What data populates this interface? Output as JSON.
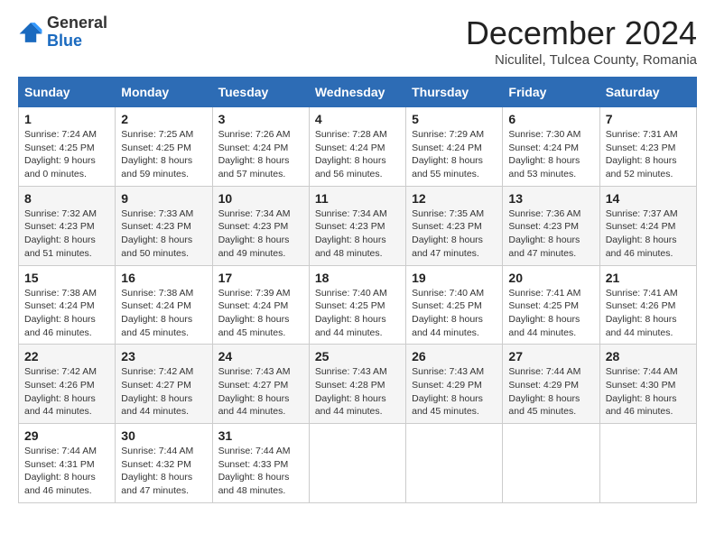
{
  "logo": {
    "general": "General",
    "blue": "Blue"
  },
  "header": {
    "month_title": "December 2024",
    "location": "Niculitel, Tulcea County, Romania"
  },
  "weekdays": [
    "Sunday",
    "Monday",
    "Tuesday",
    "Wednesday",
    "Thursday",
    "Friday",
    "Saturday"
  ],
  "weeks": [
    [
      {
        "day": 1,
        "sunrise": "7:24 AM",
        "sunset": "4:25 PM",
        "daylight": "9 hours and 0 minutes."
      },
      {
        "day": 2,
        "sunrise": "7:25 AM",
        "sunset": "4:25 PM",
        "daylight": "8 hours and 59 minutes."
      },
      {
        "day": 3,
        "sunrise": "7:26 AM",
        "sunset": "4:24 PM",
        "daylight": "8 hours and 57 minutes."
      },
      {
        "day": 4,
        "sunrise": "7:28 AM",
        "sunset": "4:24 PM",
        "daylight": "8 hours and 56 minutes."
      },
      {
        "day": 5,
        "sunrise": "7:29 AM",
        "sunset": "4:24 PM",
        "daylight": "8 hours and 55 minutes."
      },
      {
        "day": 6,
        "sunrise": "7:30 AM",
        "sunset": "4:24 PM",
        "daylight": "8 hours and 53 minutes."
      },
      {
        "day": 7,
        "sunrise": "7:31 AM",
        "sunset": "4:23 PM",
        "daylight": "8 hours and 52 minutes."
      }
    ],
    [
      {
        "day": 8,
        "sunrise": "7:32 AM",
        "sunset": "4:23 PM",
        "daylight": "8 hours and 51 minutes."
      },
      {
        "day": 9,
        "sunrise": "7:33 AM",
        "sunset": "4:23 PM",
        "daylight": "8 hours and 50 minutes."
      },
      {
        "day": 10,
        "sunrise": "7:34 AM",
        "sunset": "4:23 PM",
        "daylight": "8 hours and 49 minutes."
      },
      {
        "day": 11,
        "sunrise": "7:34 AM",
        "sunset": "4:23 PM",
        "daylight": "8 hours and 48 minutes."
      },
      {
        "day": 12,
        "sunrise": "7:35 AM",
        "sunset": "4:23 PM",
        "daylight": "8 hours and 47 minutes."
      },
      {
        "day": 13,
        "sunrise": "7:36 AM",
        "sunset": "4:23 PM",
        "daylight": "8 hours and 47 minutes."
      },
      {
        "day": 14,
        "sunrise": "7:37 AM",
        "sunset": "4:24 PM",
        "daylight": "8 hours and 46 minutes."
      }
    ],
    [
      {
        "day": 15,
        "sunrise": "7:38 AM",
        "sunset": "4:24 PM",
        "daylight": "8 hours and 46 minutes."
      },
      {
        "day": 16,
        "sunrise": "7:38 AM",
        "sunset": "4:24 PM",
        "daylight": "8 hours and 45 minutes."
      },
      {
        "day": 17,
        "sunrise": "7:39 AM",
        "sunset": "4:24 PM",
        "daylight": "8 hours and 45 minutes."
      },
      {
        "day": 18,
        "sunrise": "7:40 AM",
        "sunset": "4:25 PM",
        "daylight": "8 hours and 44 minutes."
      },
      {
        "day": 19,
        "sunrise": "7:40 AM",
        "sunset": "4:25 PM",
        "daylight": "8 hours and 44 minutes."
      },
      {
        "day": 20,
        "sunrise": "7:41 AM",
        "sunset": "4:25 PM",
        "daylight": "8 hours and 44 minutes."
      },
      {
        "day": 21,
        "sunrise": "7:41 AM",
        "sunset": "4:26 PM",
        "daylight": "8 hours and 44 minutes."
      }
    ],
    [
      {
        "day": 22,
        "sunrise": "7:42 AM",
        "sunset": "4:26 PM",
        "daylight": "8 hours and 44 minutes."
      },
      {
        "day": 23,
        "sunrise": "7:42 AM",
        "sunset": "4:27 PM",
        "daylight": "8 hours and 44 minutes."
      },
      {
        "day": 24,
        "sunrise": "7:43 AM",
        "sunset": "4:27 PM",
        "daylight": "8 hours and 44 minutes."
      },
      {
        "day": 25,
        "sunrise": "7:43 AM",
        "sunset": "4:28 PM",
        "daylight": "8 hours and 44 minutes."
      },
      {
        "day": 26,
        "sunrise": "7:43 AM",
        "sunset": "4:29 PM",
        "daylight": "8 hours and 45 minutes."
      },
      {
        "day": 27,
        "sunrise": "7:44 AM",
        "sunset": "4:29 PM",
        "daylight": "8 hours and 45 minutes."
      },
      {
        "day": 28,
        "sunrise": "7:44 AM",
        "sunset": "4:30 PM",
        "daylight": "8 hours and 46 minutes."
      }
    ],
    [
      {
        "day": 29,
        "sunrise": "7:44 AM",
        "sunset": "4:31 PM",
        "daylight": "8 hours and 46 minutes."
      },
      {
        "day": 30,
        "sunrise": "7:44 AM",
        "sunset": "4:32 PM",
        "daylight": "8 hours and 47 minutes."
      },
      {
        "day": 31,
        "sunrise": "7:44 AM",
        "sunset": "4:33 PM",
        "daylight": "8 hours and 48 minutes."
      },
      null,
      null,
      null,
      null
    ]
  ],
  "labels": {
    "sunrise": "Sunrise: ",
    "sunset": "Sunset: ",
    "daylight": "Daylight: "
  }
}
